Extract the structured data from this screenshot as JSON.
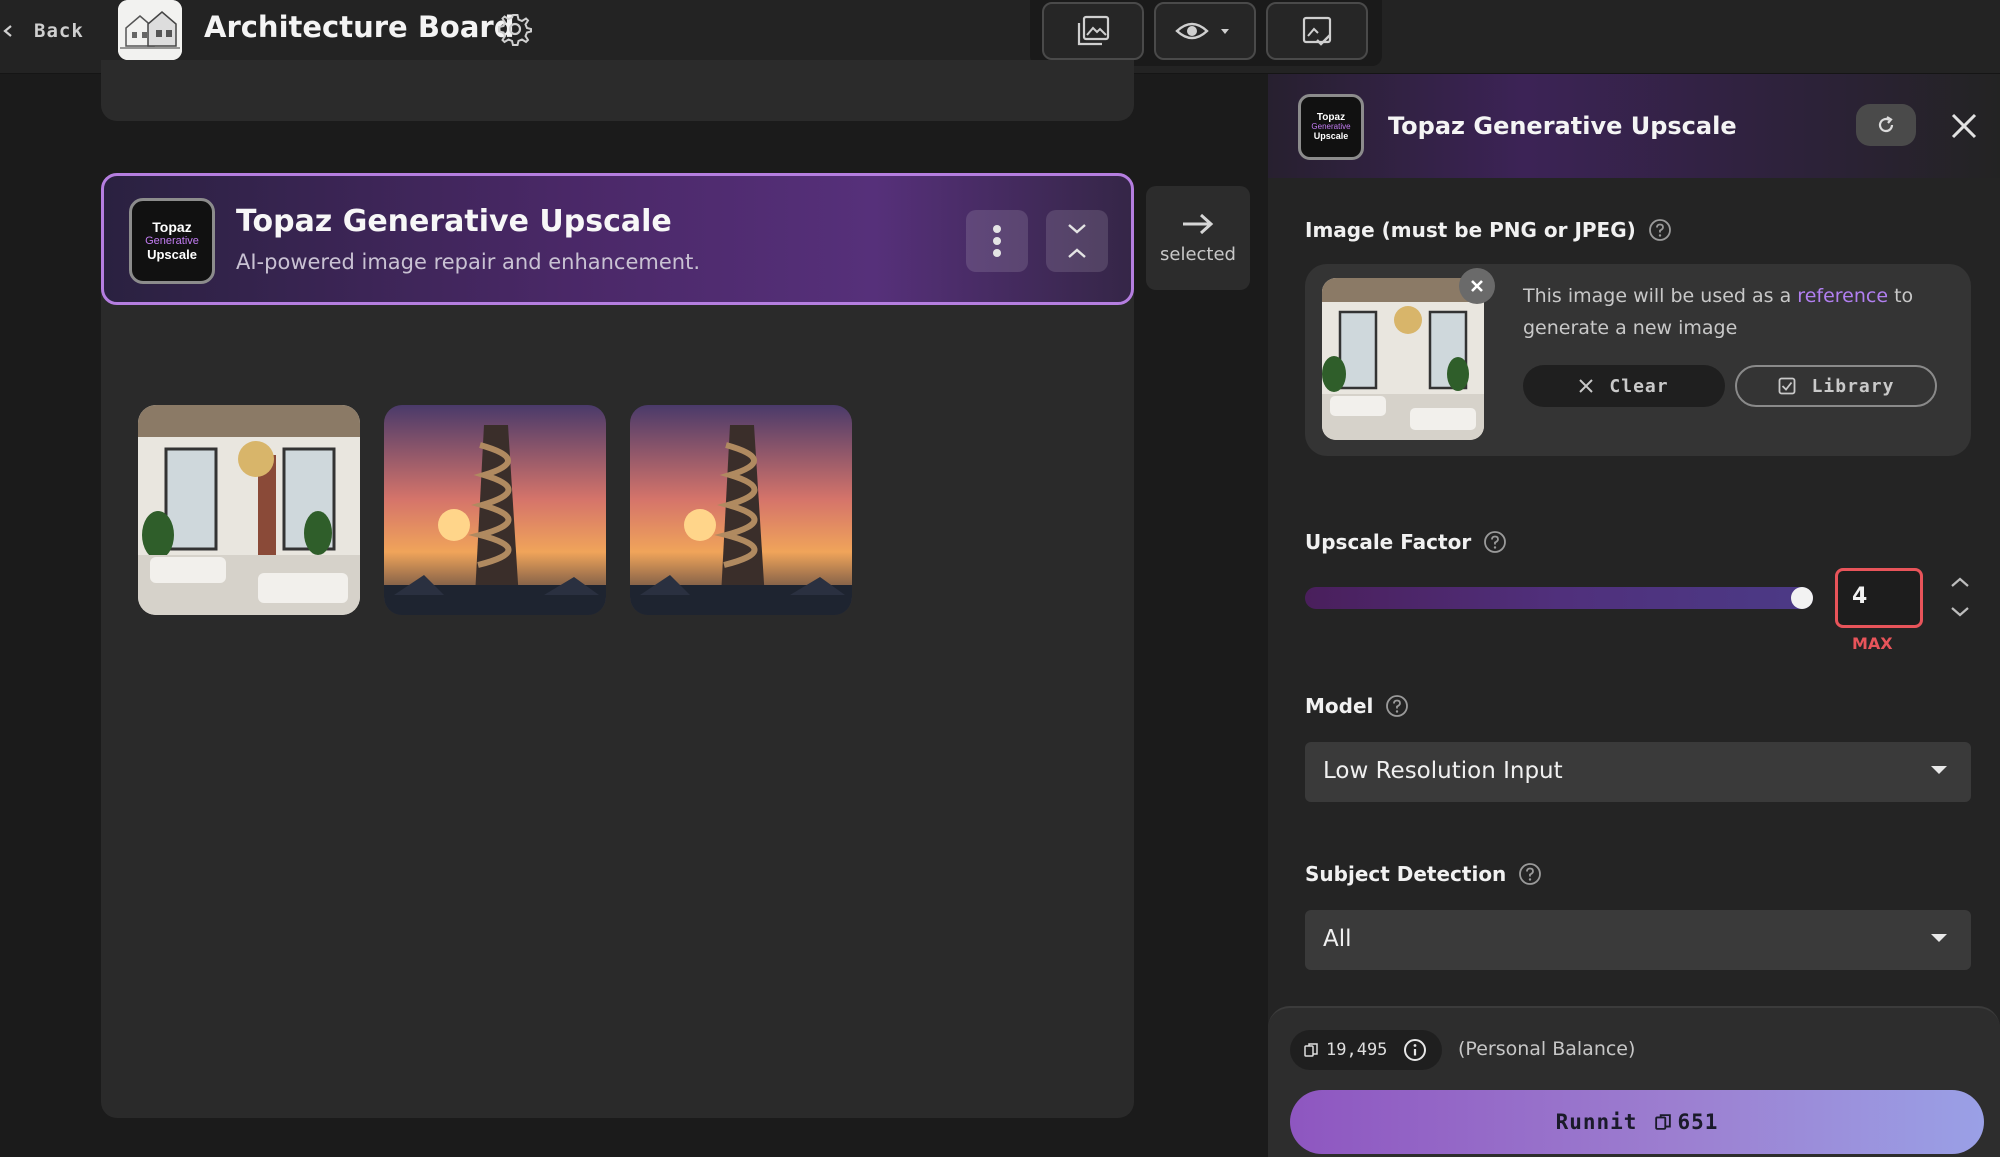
{
  "topbar": {
    "back_label": "Back",
    "board_title": "Architecture Board"
  },
  "app": {
    "title": "Topaz Generative Upscale",
    "subtitle": "AI-powered image repair and enhancement.",
    "logo_lines": [
      "Topaz",
      "Generative",
      "Upscale"
    ],
    "selected_label": "selected"
  },
  "panel": {
    "title": "Topaz Generative Upscale",
    "image": {
      "label": "Image (must be PNG or JPEG)",
      "desc_before": "This image will be used as a ",
      "desc_link": "reference",
      "desc_after": " to generate a new image",
      "clear_label": "Clear",
      "library_label": "Library"
    },
    "upscale": {
      "label": "Upscale Factor",
      "value": "4",
      "max_label": "MAX",
      "slider_fraction": 1.0
    },
    "model": {
      "label": "Model",
      "value": "Low Resolution Input"
    },
    "subject": {
      "label": "Subject Detection",
      "value": "All"
    },
    "footer": {
      "balance": "19,495",
      "balance_label": "(Personal Balance)",
      "run_label": "Runnit",
      "run_cost": "651"
    }
  },
  "colors": {
    "accent_purple": "#b57ee0",
    "link_purple": "#b17ff0",
    "error_red": "#e8545a"
  }
}
